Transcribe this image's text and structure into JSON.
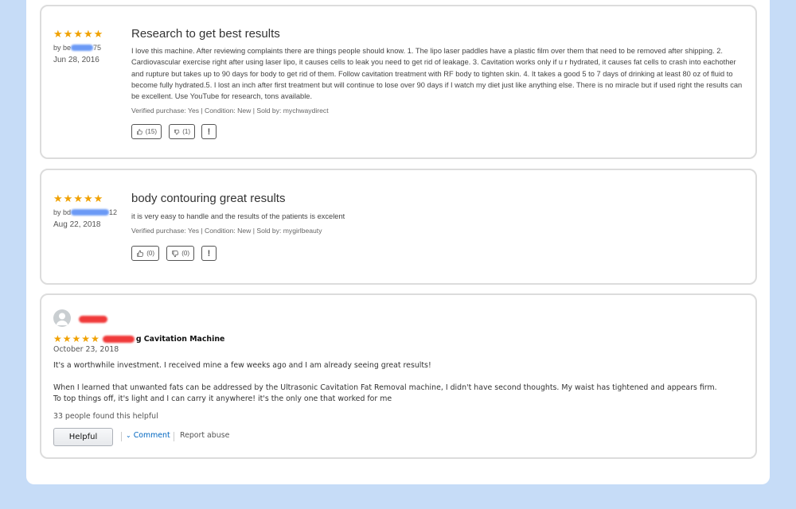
{
  "reviews": [
    {
      "rating": 5,
      "by_prefix": "by be",
      "by_suffix": "75",
      "date": "Jun 28, 2016",
      "title": "Research to get best results",
      "body": "I love this machine. After reviewing complaints there are things people should know. 1. The lipo laser paddles have a plastic film over them that need to be removed after shipping. 2. Cardiovascular exercise right after using laser lipo, it causes cells to leak you need to get rid of leakage. 3. Cavitation works only if u r hydrated, it causes fat cells to crash into eachother and rupture but takes up to 90 days for body to get rid of them. Follow cavitation treatment with RF body to tighten skin. 4. It takes a good 5 to 7 days of drinking at least 80 oz of fluid to become fully hydrated.5. I lost an inch after first treatment but will continue to lose over 90 days if I watch my diet just like anything else. There is no miracle but if used right the results can be excellent. Use YouTube for research, tons available.",
      "verified": "Verified purchase: Yes | Condition: New | Sold by: mychwaydirect",
      "up_count": "(15)",
      "down_count": "(1)",
      "flag": "!"
    },
    {
      "rating": 5,
      "by_prefix": "by bd",
      "by_suffix": "12",
      "date": "Aug 22, 2018",
      "title": "body contouring great results",
      "body": "it is very easy to handle and the results of the patients is excelent",
      "verified": "Verified purchase: Yes | Condition: New | Sold by: mygirlbeauty",
      "up_count": "(0)",
      "down_count": "(0)",
      "flag": "!"
    }
  ],
  "amazon_review": {
    "rating": 5,
    "title_suffix": "g Cavitation Machine",
    "date": "October 23, 2018",
    "para1": "It's a worthwhile investment. I received mine a few weeks ago and I am already seeing great results!",
    "para2_line1": "When I learned that unwanted fats can be addressed by the Ultrasonic Cavitation Fat Removal machine, I didn't have second thoughts. My waist has tightened and appears firm.",
    "para2_line2": "To top things off, it's light and I can carry it anywhere! it's the only one that worked for me",
    "helpful_count": "33 people found this helpful",
    "helpful_label": "Helpful",
    "comment_label": "Comment",
    "report_label": "Report abuse"
  },
  "colors": {
    "star": "#f0a100",
    "link": "#0066c0",
    "background": "#c6dcf7"
  }
}
